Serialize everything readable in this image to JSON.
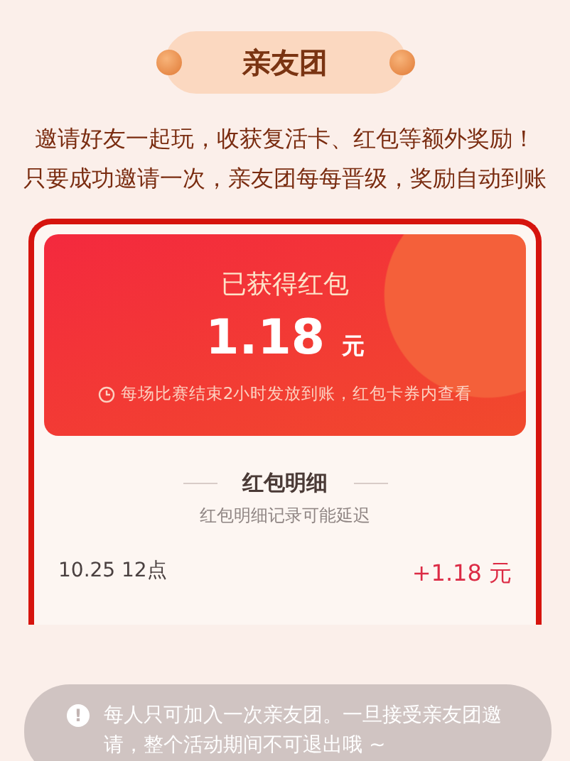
{
  "header": {
    "title": "亲友团"
  },
  "intro": [
    "邀请好友一起玩，收获复活卡、红包等额外奖励！",
    "只要成功邀请一次，亲友团每每晋级，奖励自动到账"
  ],
  "reward": {
    "title": "已获得红包",
    "amount": "1.18",
    "unit": "元",
    "note": "每场比赛结束2小时发放到账，红包卡券内查看"
  },
  "details": {
    "title": "红包明细",
    "subtitle": "红包明细记录可能延迟",
    "rows": [
      {
        "time": "10.25 12点",
        "amount": "+1.18 元"
      }
    ]
  },
  "toast": {
    "icon": "!",
    "text": "每人只可加入一次亲友团。一旦接受亲友团邀请，整个活动期间不可退出哦 ~"
  }
}
